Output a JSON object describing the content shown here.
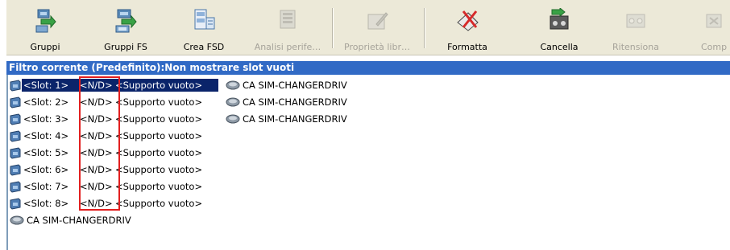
{
  "toolbar": {
    "buttons": [
      {
        "label": "Gruppi",
        "icon": "groups-icon",
        "disabled": false
      },
      {
        "label": "Gruppi FS",
        "icon": "fs-groups-icon",
        "disabled": false
      },
      {
        "label": "Crea FSD",
        "icon": "create-fsd-icon",
        "disabled": false
      },
      {
        "label": "Analisi perife…",
        "icon": "device-scan-icon",
        "disabled": true
      },
      {
        "label": "Proprietà libr…",
        "icon": "library-properties-icon",
        "disabled": true
      },
      {
        "label": "Formatta",
        "icon": "format-icon",
        "disabled": false
      },
      {
        "label": "Cancella",
        "icon": "erase-icon",
        "disabled": false
      },
      {
        "label": "Ritensiona",
        "icon": "retension-icon",
        "disabled": true
      },
      {
        "label": "Comp",
        "icon": "compress-icon",
        "disabled": true
      }
    ]
  },
  "filter": {
    "text": "Filtro corrente (Predefinito):Non mostrare slot vuoti"
  },
  "tree": {
    "slots": [
      {
        "slot": "<Slot:  1>",
        "status": "<N/D>",
        "media": "<Supporto vuoto>",
        "device": "CA SIM-CHANGERDRIV",
        "selected": true
      },
      {
        "slot": "<Slot:  2>",
        "status": "<N/D>",
        "media": "<Supporto vuoto>",
        "device": "CA SIM-CHANGERDRIV",
        "selected": false
      },
      {
        "slot": "<Slot:  3>",
        "status": "<N/D>",
        "media": "<Supporto vuoto>",
        "device": "CA SIM-CHANGERDRIV",
        "selected": false
      },
      {
        "slot": "<Slot:  4>",
        "status": "<N/D>",
        "media": "<Supporto vuoto>",
        "device": "",
        "selected": false
      },
      {
        "slot": "<Slot:  5>",
        "status": "<N/D>",
        "media": "<Supporto vuoto>",
        "device": "",
        "selected": false
      },
      {
        "slot": "<Slot:  6>",
        "status": "<N/D>",
        "media": "<Supporto vuoto>",
        "device": "",
        "selected": false
      },
      {
        "slot": "<Slot:  7>",
        "status": "<N/D>",
        "media": "<Supporto vuoto>",
        "device": "",
        "selected": false
      },
      {
        "slot": "<Slot:  8>",
        "status": "<N/D>",
        "media": "<Supporto vuoto>",
        "device": "",
        "selected": false
      }
    ],
    "drive": {
      "label": "CA SIM-CHANGERDRIV",
      "icon": "tape-drive-icon"
    }
  },
  "colors": {
    "filter_bar": "#316ac5",
    "selection": "#0a246a",
    "highlight": "#e21f1f",
    "toolbar_bg": "#ece9d8"
  }
}
